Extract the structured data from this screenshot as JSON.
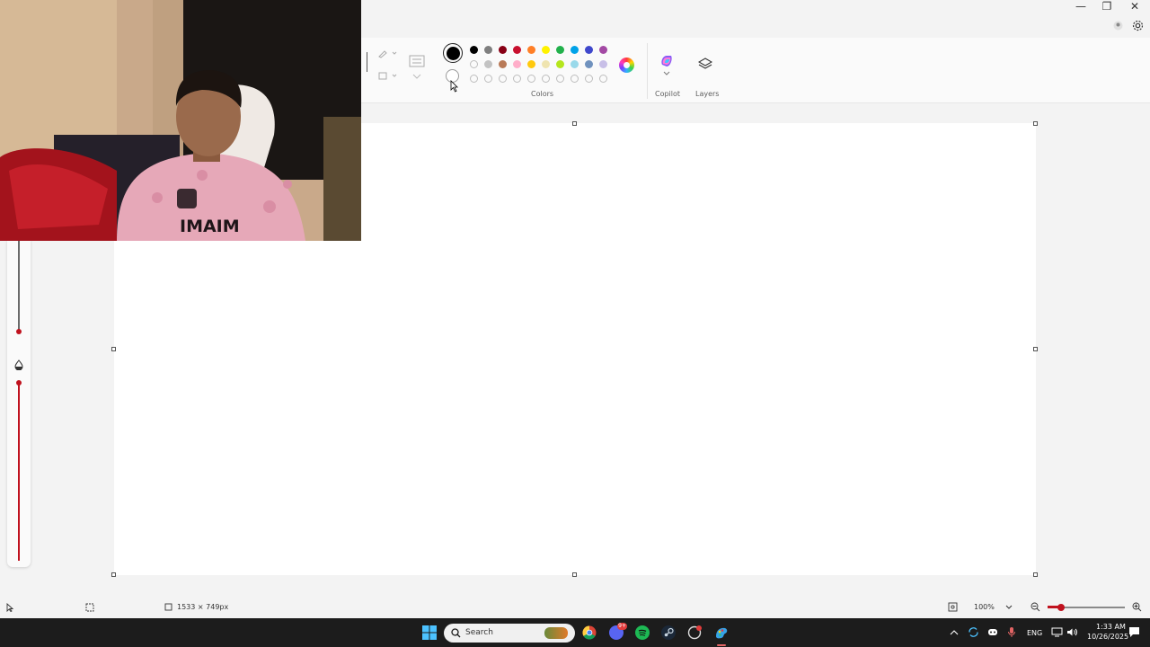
{
  "window": {
    "minimize": "—",
    "restore": "❐",
    "close": "✕"
  },
  "ribbon": {
    "colors_label": "Colors",
    "copilot_label": "Copilot",
    "layers_label": "Layers",
    "primary_color": "#000000",
    "secondary_color": "#ffffff",
    "palette_row1": [
      "#000000",
      "#7f7f7f",
      "#880015",
      "#c8102e",
      "#ff7f27",
      "#fff200",
      "#22b14c",
      "#00a2e8",
      "#3f48cc",
      "#a349a4"
    ],
    "palette_row2": [
      "",
      "#c3c3c3",
      "#b97a57",
      "#ffaec9",
      "#ffc90e",
      "#efe4b0",
      "#b5e61d",
      "#99d9ea",
      "#7092be",
      "#c8bfe7"
    ],
    "palette_row3": [
      "",
      "",
      "",
      "",
      "",
      "",
      "",
      "",
      "",
      ""
    ]
  },
  "status": {
    "canvas_size": "1533 × 749px",
    "zoom": "100%"
  },
  "taskbar": {
    "search_placeholder": "Search",
    "language": "ENG",
    "time": "1:33 AM",
    "date": "10/26/2025",
    "discord_badge": "9+"
  },
  "webcam_overlay": {
    "shirt_text": "IMAIM"
  }
}
